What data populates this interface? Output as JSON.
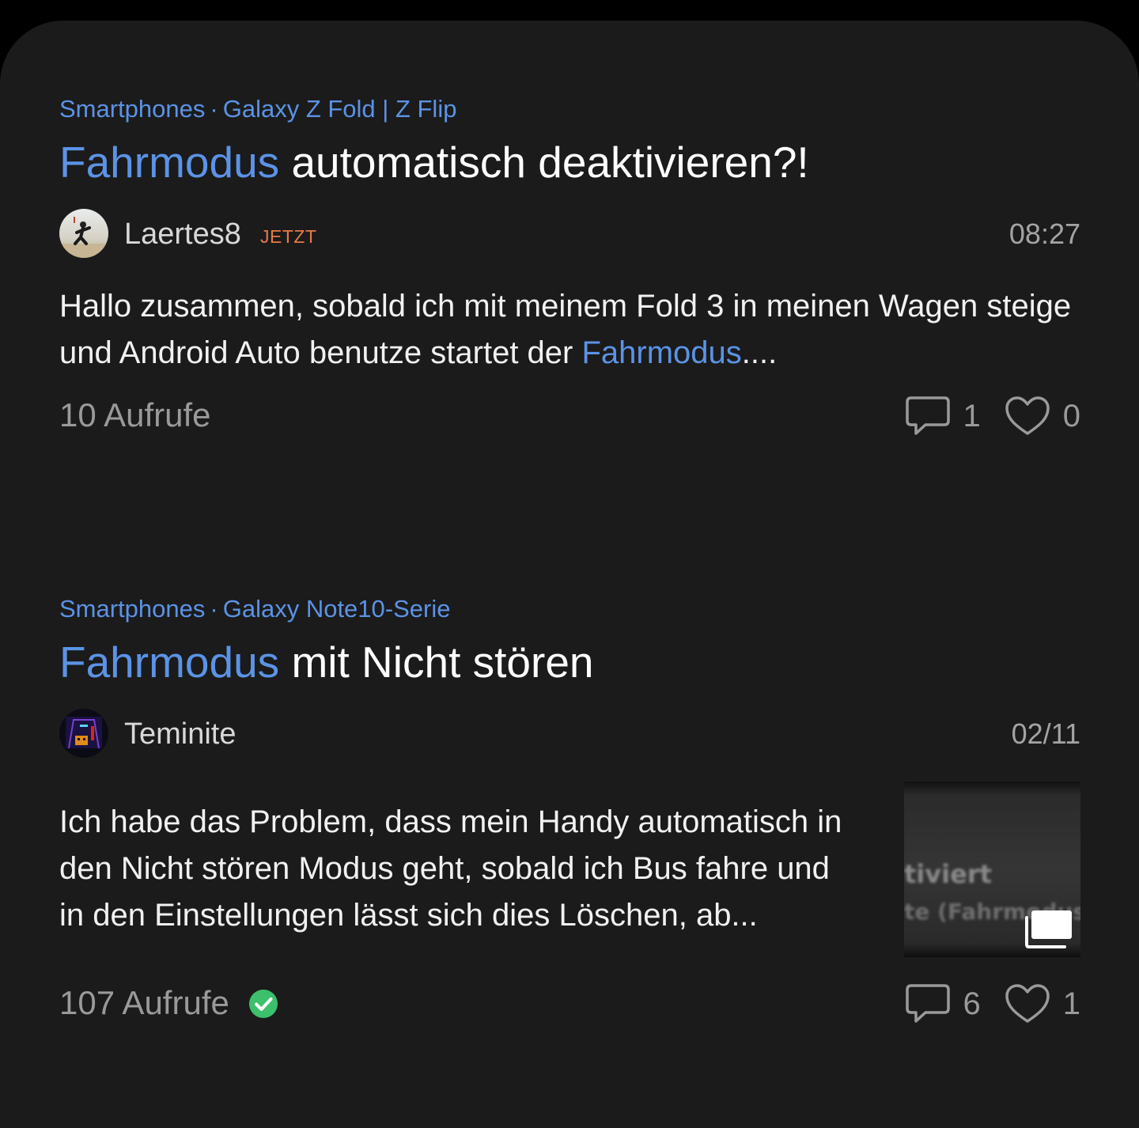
{
  "posts": [
    {
      "breadcrumb": {
        "category": "Smartphones",
        "separator": "·",
        "subcategory": "Galaxy Z Fold | Z Flip"
      },
      "title": {
        "highlight": "Fahrmodus",
        "rest": " automatisch deaktivieren?!"
      },
      "author": {
        "name": "Laertes8",
        "badge": "JETZT",
        "avatar_icon": "user-avatar"
      },
      "time": "08:27",
      "excerpt": {
        "before": "Hallo zusammen, sobald ich mit meinem Fold 3 in meinen Wagen steige und Android Auto benutze startet der ",
        "highlight": "Fahrmodus",
        "after": "...."
      },
      "views": "10 Aufrufe",
      "comments": "1",
      "likes": "0",
      "icons": {
        "comments": "comment-icon",
        "likes": "heart-icon"
      }
    },
    {
      "breadcrumb": {
        "category": "Smartphones",
        "separator": "·",
        "subcategory": "Galaxy Note10-Serie"
      },
      "title": {
        "highlight": "Fahrmodus",
        "rest": " mit Nicht stören"
      },
      "author": {
        "name": "Teminite",
        "avatar_icon": "user-avatar"
      },
      "time": "02/11",
      "excerpt": {
        "text": "Ich habe das Problem, dass mein Handy automatisch in den Nicht stören Modus geht, sobald ich Bus fahre und in den Einstellungen lässt sich dies Löschen, ab..."
      },
      "views": "107 Aufrufe",
      "solved_icon": "check-circle-icon",
      "comments": "6",
      "likes": "1",
      "thumbnail": {
        "line1": "tiviert",
        "line2": "te (Fahrmodus)",
        "icon": "gallery-icon"
      },
      "icons": {
        "comments": "comment-icon",
        "likes": "heart-icon"
      }
    }
  ],
  "colors": {
    "background": "#1b1b1b",
    "accent": "#5b93e6",
    "badge": "#e77a45",
    "muted": "#9a9a9a",
    "success": "#3cc06b"
  }
}
